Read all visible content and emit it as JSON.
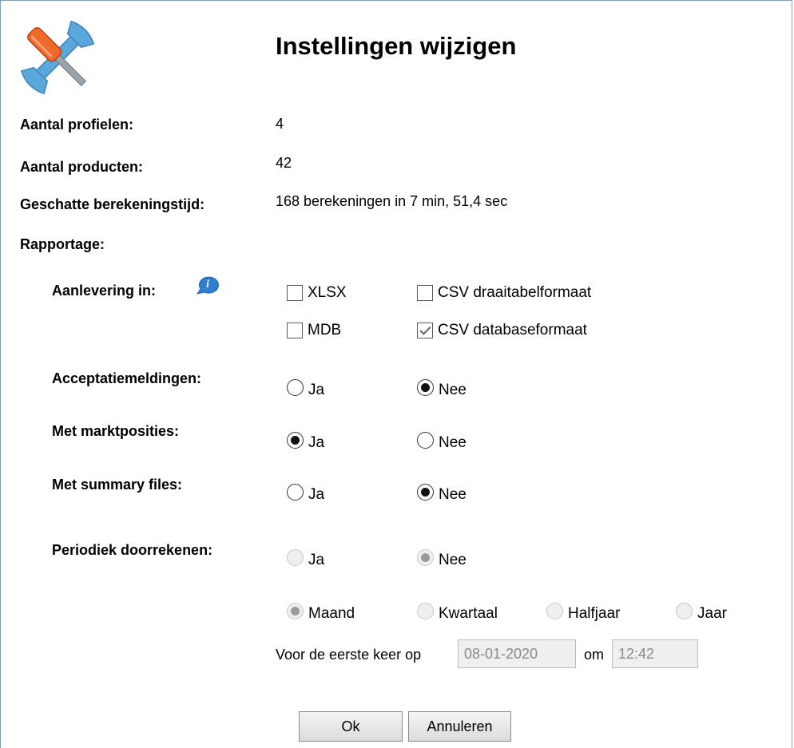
{
  "dialog": {
    "title": "Instellingen wijzigen",
    "icon": "tools-icon"
  },
  "info": {
    "profielen_label": "Aantal profielen:",
    "profielen_value": "4",
    "producten_label": "Aantal producten:",
    "producten_value": "42",
    "tijd_label": "Geschatte berekeningstijd:",
    "tijd_value": "168 berekeningen in 7 min, 51,4 sec",
    "rapportage_label": "Rapportage:"
  },
  "aanlevering": {
    "label": "Aanlevering in:",
    "info_icon": "info-icon",
    "options": [
      {
        "label": "XLSX",
        "checked": false
      },
      {
        "label": "CSV draaitabelformaat",
        "checked": false
      },
      {
        "label": "MDB",
        "checked": false
      },
      {
        "label": "CSV databaseformaat",
        "checked": true
      }
    ]
  },
  "acceptatie": {
    "label": "Acceptatiemeldingen:",
    "ja": "Ja",
    "nee": "Nee",
    "selected": "Nee"
  },
  "marktposities": {
    "label": "Met marktposities:",
    "ja": "Ja",
    "nee": "Nee",
    "selected": "Ja"
  },
  "summary": {
    "label": "Met summary files:",
    "ja": "Ja",
    "nee": "Nee",
    "selected": "Nee"
  },
  "periodiek": {
    "label": "Periodiek doorrekenen:",
    "ja": "Ja",
    "nee": "Nee",
    "selected": "Nee",
    "period_options": [
      "Maand",
      "Kwartaal",
      "Halfjaar",
      "Jaar"
    ],
    "period_selected": "Maand",
    "first_time_label": "Voor de eerste keer op",
    "date_value": "08-01-2020",
    "om_label": "om",
    "time_value": "12:42"
  },
  "buttons": {
    "ok": "Ok",
    "cancel": "Annuleren"
  },
  "colors": {
    "disabled": "#efefef",
    "border": "#7f9db9"
  }
}
